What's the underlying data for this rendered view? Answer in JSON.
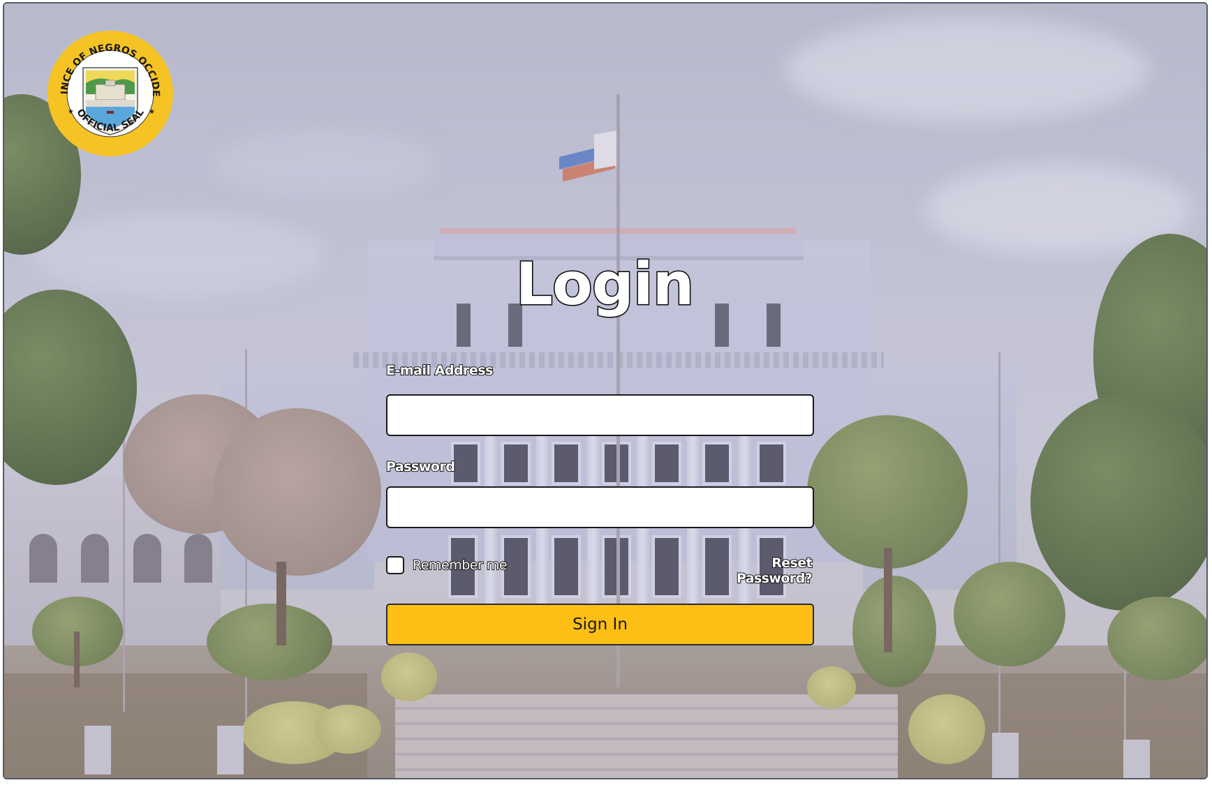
{
  "seal": {
    "top_text": "PROVINCE OF NEGROS OCCIDENTAL",
    "bottom_text": "OFFICIAL SEAL"
  },
  "login": {
    "title": "Login",
    "email_label": "E-mail Address",
    "email_value": "",
    "password_label": "Password",
    "password_value": "",
    "remember_label": "Remember me",
    "remember_checked": false,
    "reset_link": "Reset Password?",
    "signin_label": "Sign In"
  },
  "colors": {
    "accent": "#fdbf16",
    "seal_ring": "#f6c324",
    "field_bg": "#ffffff"
  },
  "icons": {
    "logo": "negros-occidental-seal-icon"
  }
}
